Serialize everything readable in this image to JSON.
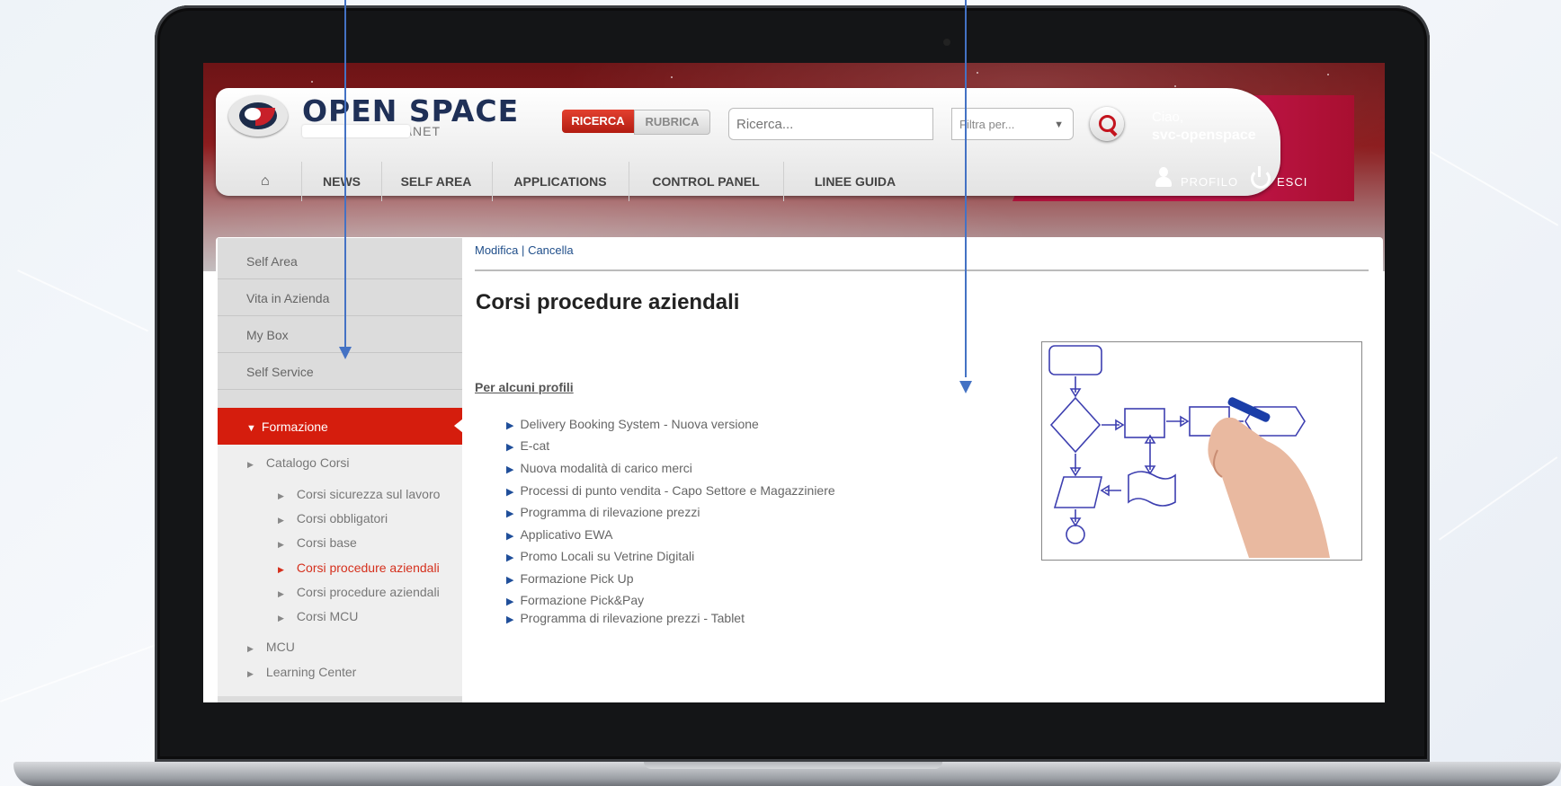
{
  "header": {
    "brand": "OPEN SPACE",
    "brand_sub": "INTRANET",
    "search_tabs": [
      "RICERCA",
      "RUBRICA"
    ],
    "search_placeholder": "Ricerca...",
    "filter_placeholder": "Filtra per...",
    "greeting": "Ciao,",
    "username": "svc-openspace",
    "profile_label": "PROFILO",
    "logout_label": "ESCI"
  },
  "nav": {
    "items": [
      "NEWS",
      "SELF AREA",
      "APPLICATIONS",
      "CONTROL PANEL",
      "LINEE GUIDA"
    ]
  },
  "sidebar": {
    "items": [
      "Self Area",
      "Vita in Azienda",
      "My Box",
      "Self Service",
      "Formazione"
    ],
    "sub_items": [
      "Catalogo Corsi",
      "MCU",
      "Learning Center"
    ],
    "catalog_items": [
      "Corsi sicurezza sul lavoro",
      "Corsi obbligatori",
      "Corsi base",
      "Corsi procedure aziendali",
      "Corsi procedure aziendali",
      "Corsi MCU"
    ]
  },
  "main": {
    "edit_link": "Modifica",
    "separator": "|",
    "delete_link": "Cancella",
    "title": "Corsi procedure aziendali",
    "section_heading": "Per alcuni profili",
    "courses": [
      "Delivery Booking System - Nuova versione",
      "E-cat",
      "Nuova modalità di carico merci",
      "Processi di punto vendita - Capo Settore e Magazziniere",
      "Programma di rilevazione prezzi",
      "Applicativo EWA",
      "Promo Locali su Vetrine Digitali",
      "Formazione Pick Up",
      "Formazione Pick&Pay",
      "Programma di rilevazione prezzi - Tablet"
    ]
  },
  "colors": {
    "accent_red": "#d51d0d",
    "link_blue": "#1f4e8a",
    "annotation_arrow": "#4472c4"
  }
}
